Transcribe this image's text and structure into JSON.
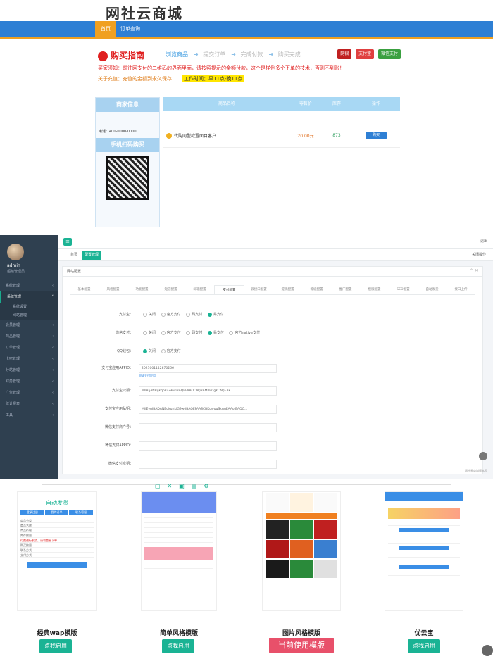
{
  "store": {
    "logo": "网社云商城",
    "nav": {
      "home": "首页",
      "orders": "订单查询"
    },
    "guide_title": "购买指南",
    "steps": [
      "浏览商品",
      "提交订单",
      "完成付款",
      "购买完成"
    ],
    "pay_badges": [
      {
        "label": "网银",
        "color": "#c02020"
      },
      {
        "label": "支付宝",
        "color": "#e04040"
      },
      {
        "label": "微信支付",
        "color": "#3aa040"
      }
    ],
    "notice_red": "买家须知：前往网支付的二维码的界面里面，请按照提示的金额付款，这个是样例多个下单的技术，否则不到账！",
    "notice_orange": "关于充值：充值的金额到永久保存",
    "hours": "工作时间：早11点-晚11点",
    "seller_title": "商家信息",
    "seller_phone": "电话：400-0000-0000",
    "qr_title": "手机扫码购买",
    "table": {
      "headers": [
        "商品名称",
        "零售价",
        "库存",
        "操作"
      ],
      "rows": [
        {
          "name": "代购同型款置面目客户…",
          "price": "20.00元",
          "stock": "873",
          "action": "购买"
        }
      ]
    }
  },
  "admin": {
    "user": "admin",
    "role": "超级管理员",
    "menu": [
      {
        "label": "系统管理",
        "active": false
      },
      {
        "label": "系统管理",
        "active": true
      },
      {
        "label": "系统设置",
        "sub": true
      },
      {
        "label": "网站管理",
        "sub": true
      },
      {
        "label": "会员管理",
        "active": false
      },
      {
        "label": "商品管理",
        "active": false
      },
      {
        "label": "订单管理",
        "active": false
      },
      {
        "label": "卡密管理",
        "active": false
      },
      {
        "label": "分站管理",
        "active": false
      },
      {
        "label": "财务管理",
        "active": false
      },
      {
        "label": "广告管理",
        "active": false
      },
      {
        "label": "统计报表",
        "active": false
      },
      {
        "label": "工具",
        "active": false
      }
    ],
    "logout": "退出",
    "tab_home": "首页",
    "tab_current": "配置管理",
    "tab_ops": "关闭操作",
    "panel_title": "网站配置",
    "settings_tabs": [
      "基本配置",
      "风格配置",
      "功能配置",
      "短信配置",
      "邮箱配置",
      "支付配置",
      "云接口配置",
      "提现配置",
      "等级配置",
      "推广配置",
      "模版配置",
      "SEO配置",
      "自动发货",
      "接口上传"
    ],
    "form": [
      {
        "label": "支付宝：",
        "type": "radio",
        "options": [
          "关闭",
          "官方支付",
          "码支付",
          "易支付"
        ],
        "selected": 3
      },
      {
        "label": "微信支付：",
        "type": "radio",
        "options": [
          "关闭",
          "官方支付",
          "码支付",
          "易支付",
          "官方native支付"
        ],
        "selected": 3
      },
      {
        "label": "QQ钱包：",
        "type": "radio",
        "options": [
          "关闭",
          "官方支付"
        ],
        "selected": 0
      },
      {
        "label": "支付宝应用APPID：",
        "type": "input",
        "value": "2021001142870266",
        "hint": "申请支付应用"
      },
      {
        "label": "支付宝公钥：",
        "type": "input",
        "value": "MIIBIjANBgkqhkiG9w0BAQEFAAOCAQ8AMIIBCgKCAQEAk…"
      },
      {
        "label": "支付宝应用私钥：",
        "type": "input",
        "value": "MIIEvgIBADANBgkqhkiG9w0BAQEFAASCBKgwggSkAgEAAoIBAQC…"
      },
      {
        "label": "微信支付商户号：",
        "type": "input",
        "value": ""
      },
      {
        "label": "微信支付APPID：",
        "type": "input",
        "value": ""
      },
      {
        "label": "微信支付密钥：",
        "type": "input",
        "value": ""
      }
    ],
    "footer_note": "网社云商城版本号"
  },
  "templates": [
    {
      "name": "经典wap模版",
      "button": "点我启用",
      "current": false
    },
    {
      "name": "简单风格模版",
      "button": "点我启用",
      "current": false
    },
    {
      "name": "图片风格模版",
      "button": "当前使用模版",
      "current": true
    },
    {
      "name": "优云宝",
      "button": "点我启用",
      "current": false
    }
  ],
  "mini": {
    "t1_title": "自动发货",
    "t1_tabs": [
      "登录注册",
      "我的订单",
      "联系客服"
    ],
    "t1_lines": [
      "商品分类",
      "商品名称",
      "商品价格",
      "库存数量",
      "购买数量",
      "联系方式",
      "支付方式"
    ],
    "t1_alert": "付费进行发货，请勿重复下单"
  }
}
